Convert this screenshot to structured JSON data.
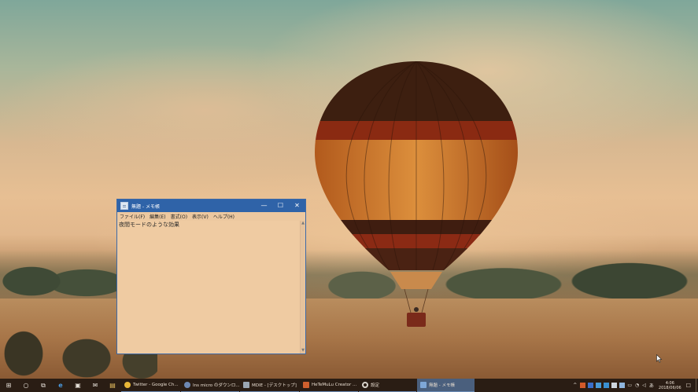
{
  "window": {
    "title": "無題 - メモ帳",
    "menu": [
      "ファイル(F)",
      "編集(E)",
      "書式(O)",
      "表示(V)",
      "ヘルプ(H)"
    ],
    "content": "夜間モードのような効果",
    "controls": {
      "minimize": "—",
      "maximize": "☐",
      "close": "✕"
    }
  },
  "taskbar": {
    "system_icons": {
      "start": "⊞",
      "search": "○",
      "task_view": "⧉",
      "edge": "e",
      "store": "▣",
      "mail": "✉",
      "explorer": "▤"
    },
    "apps": [
      {
        "label": "Twitter - Google Ch...",
        "color": "#e9b737"
      },
      {
        "label": "Ins micro のダウンロ...",
        "color": "#6d88b3"
      },
      {
        "label": "MDIE - [デスクトップ]",
        "color": "#9aa6b3"
      },
      {
        "label": "HeTeMuLu Creator ...",
        "color": "#d0602e"
      },
      {
        "label": "設定",
        "color": "#d9d4cc"
      },
      {
        "label": "無題 - メモ帳",
        "color": "#7ea7d8"
      }
    ],
    "tray": {
      "chevron": "^",
      "squares": [
        "#d25a2a",
        "#3b6fc9",
        "#4a9bd6",
        "#3a8fd0",
        "#cfd6de",
        "#8fb5dd"
      ],
      "battery": "▭",
      "network": "◔",
      "volume": "◁",
      "ime": "あ",
      "time": "4:06",
      "date": "2018/06/06",
      "notifications": "☐"
    }
  },
  "colors": {
    "titlebar": "#2f63a8",
    "taskbar": "#2a1d14"
  }
}
